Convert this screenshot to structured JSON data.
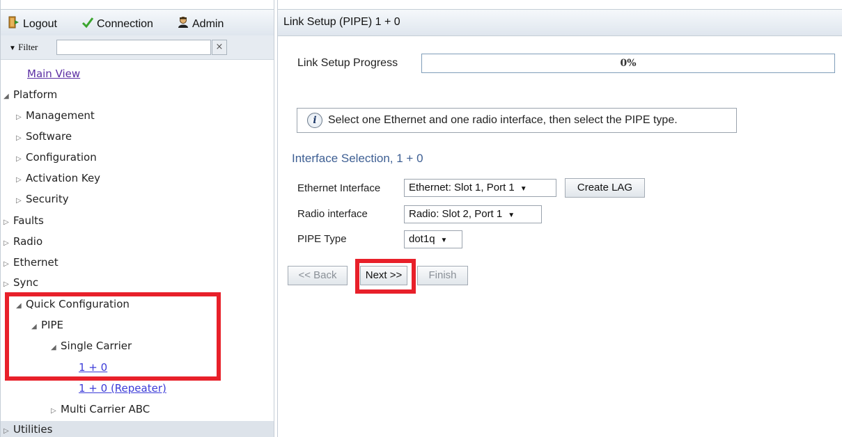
{
  "topbar": {
    "logout_label": "Logout",
    "connection_label": "Connection",
    "admin_label": "Admin"
  },
  "filter": {
    "label": "Filter",
    "value": "",
    "clear_label": "×"
  },
  "tree": {
    "main_view": "Main View",
    "platform": "Platform",
    "management": "Management",
    "software": "Software",
    "configuration": "Configuration",
    "activation_key": "Activation Key",
    "security": "Security",
    "faults": "Faults",
    "radio": "Radio",
    "ethernet": "Ethernet",
    "sync": "Sync",
    "quick_configuration": "Quick Configuration",
    "pipe": "PIPE",
    "single_carrier": "Single Carrier",
    "one_plus_zero": "1 + 0",
    "one_plus_zero_repeater": "1 + 0 (Repeater)",
    "multi_carrier_abc": "Multi Carrier ABC",
    "utilities": "Utilities"
  },
  "main": {
    "title": "Link Setup (PIPE) 1 + 0",
    "progress_label": "Link Setup Progress",
    "progress_value": "0%",
    "progress_fraction": 0,
    "info_text": "Select one Ethernet and one radio interface, then select the PIPE type.",
    "section_title": "Interface Selection, 1 + 0",
    "ethernet_label": "Ethernet Interface",
    "ethernet_value": "Ethernet: Slot 1, Port 1",
    "create_lag_label": "Create LAG",
    "radio_label": "Radio interface",
    "radio_value": "Radio: Slot 2, Port 1",
    "pipe_type_label": "PIPE Type",
    "pipe_type_value": "dot1q",
    "back_label": "<< Back",
    "next_label": "Next >>",
    "finish_label": "Finish"
  },
  "colors": {
    "highlight": "#e8202a",
    "section_title": "#3e5f93",
    "link": "#5b2ea3",
    "selected_link": "#3b3bd8"
  },
  "icons": {
    "logout": "logout-door-icon",
    "connection": "checkmark-icon",
    "admin": "admin-user-icon",
    "info": "info-icon",
    "tree_expanded": "triangle-down-icon",
    "tree_collapsed": "triangle-right-icon"
  }
}
